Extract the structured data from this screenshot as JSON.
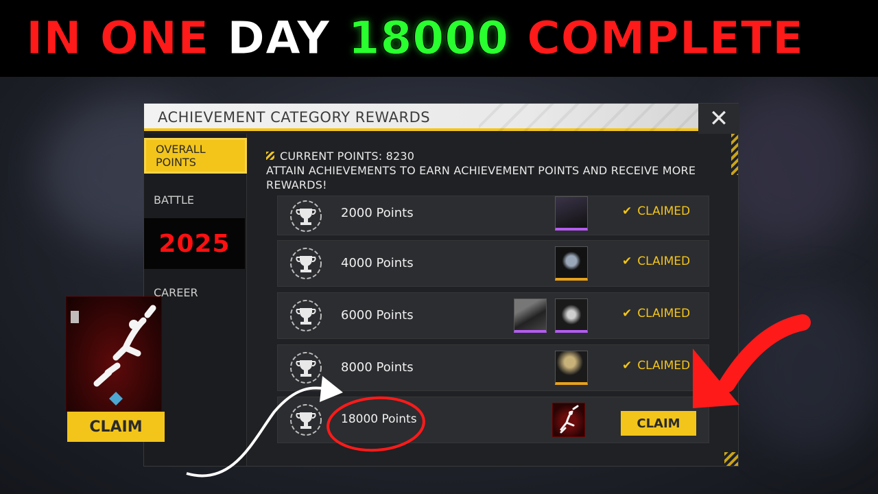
{
  "banner": {
    "word1": "IN",
    "word2": "ONE",
    "word3": "DAY",
    "word4": "18000",
    "word5": "COMPLETE",
    "colors": {
      "red": "#ff1a1a",
      "white": "#ffffff",
      "green": "#29ff2e"
    }
  },
  "dialog": {
    "title": "ACHIEVEMENT CATEGORY REWARDS",
    "close_icon": "close-icon"
  },
  "sidebar": {
    "tabs": [
      {
        "label": "OVERALL POINTS",
        "active": true
      },
      {
        "label": "BATTLE",
        "active": false
      },
      {
        "label": "2025",
        "active": false
      },
      {
        "label": "CAREER",
        "active": false
      }
    ]
  },
  "info": {
    "current_points": "CURRENT POINTS: 8230",
    "description": "ATTAIN ACHIEVEMENTS TO EARN ACHIEVEMENT POINTS AND RECEIVE MORE REWARDS!"
  },
  "rewards": [
    {
      "points": "2000 Points",
      "status": "CLAIMED",
      "icon": "trophy-icon"
    },
    {
      "points": "4000 Points",
      "status": "CLAIMED",
      "icon": "trophy-icon"
    },
    {
      "points": "6000 Points",
      "status": "CLAIMED",
      "icon": "trophy-icon"
    },
    {
      "points": "8000 Points",
      "status": "CLAIMED",
      "icon": "trophy-icon"
    },
    {
      "points": "18000 Points",
      "status": "CLAIM",
      "icon": "trophy-icon"
    }
  ],
  "left_card": {
    "claim_label": "CLAIM"
  },
  "accent": "#f3c51b"
}
